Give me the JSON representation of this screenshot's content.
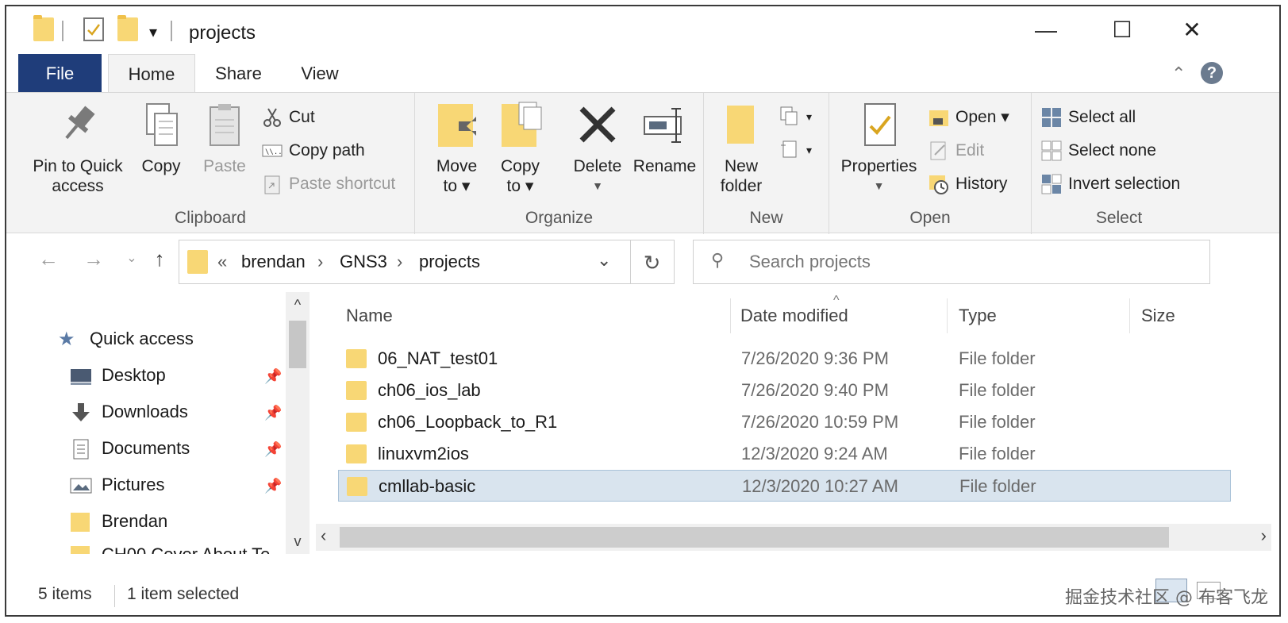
{
  "window": {
    "title": "projects",
    "minimize_glyph": "—",
    "maximize_glyph": "☐",
    "close_glyph": "✕"
  },
  "ribbon_tabs": [
    {
      "label": "File"
    },
    {
      "label": "Home"
    },
    {
      "label": "Share"
    },
    {
      "label": "View"
    }
  ],
  "ribbon": {
    "clipboard": {
      "group_label": "Clipboard",
      "pin_label": "Pin to Quick access",
      "copy_label": "Copy",
      "paste_label": "Paste",
      "cut_label": "Cut",
      "copy_path_label": "Copy path",
      "paste_shortcut_label": "Paste shortcut"
    },
    "organize": {
      "group_label": "Organize",
      "move_to_label": "Move to ▾",
      "copy_to_label": "Copy to ▾",
      "delete_label": "Delete",
      "rename_label": "Rename"
    },
    "new": {
      "group_label": "New",
      "new_folder_label": "New folder"
    },
    "open": {
      "group_label": "Open",
      "properties_label": "Properties",
      "open_label": "Open ▾",
      "edit_label": "Edit",
      "history_label": "History"
    },
    "select": {
      "group_label": "Select",
      "select_all_label": "Select all",
      "select_none_label": "Select none",
      "invert_selection_label": "Invert selection"
    }
  },
  "address": {
    "crumbs": [
      "brendan",
      "GNS3",
      "projects"
    ],
    "overflow_glyph": "«",
    "separator": "›"
  },
  "search": {
    "placeholder": "Search projects"
  },
  "nav_pane": {
    "items": [
      {
        "label": "Quick access",
        "icon": "star-icon",
        "pinned": false
      },
      {
        "label": "Desktop",
        "icon": "desktop-icon",
        "pinned": true
      },
      {
        "label": "Downloads",
        "icon": "download-icon",
        "pinned": true
      },
      {
        "label": "Documents",
        "icon": "document-icon",
        "pinned": true
      },
      {
        "label": "Pictures",
        "icon": "pictures-icon",
        "pinned": true
      },
      {
        "label": "Brendan",
        "icon": "folder-icon",
        "pinned": false
      },
      {
        "label": "CH00 Cover About Te",
        "icon": "folder-icon",
        "pinned": false
      }
    ]
  },
  "file_list": {
    "columns": [
      "Name",
      "Date modified",
      "Type",
      "Size"
    ],
    "rows": [
      {
        "name": "06_NAT_test01",
        "date": "7/26/2020 9:36 PM",
        "type": "File folder",
        "selected": false
      },
      {
        "name": "ch06_ios_lab",
        "date": "7/26/2020 9:40 PM",
        "type": "File folder",
        "selected": false
      },
      {
        "name": "ch06_Loopback_to_R1",
        "date": "7/26/2020 10:59 PM",
        "type": "File folder",
        "selected": false
      },
      {
        "name": "linuxvm2ios",
        "date": "12/3/2020 9:24 AM",
        "type": "File folder",
        "selected": false
      },
      {
        "name": "cmllab-basic",
        "date": "12/3/2020 10:27 AM",
        "type": "File folder",
        "selected": true
      }
    ]
  },
  "status": {
    "items_count": "5 items",
    "selected_count": "1 item selected"
  },
  "watermark": "掘金技术社区 @ 布客飞龙",
  "colors": {
    "file_tab": "#1f3d7a",
    "folder": "#f8d775",
    "selection": "#d9e4ee"
  }
}
